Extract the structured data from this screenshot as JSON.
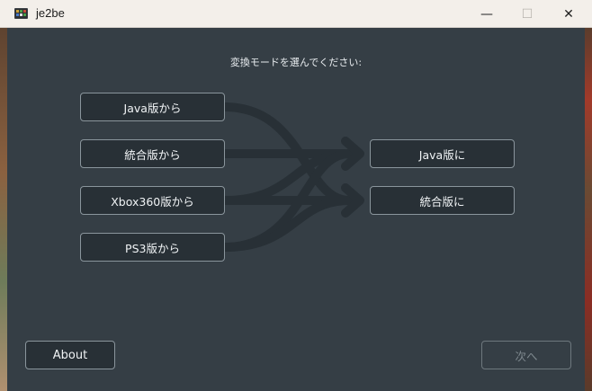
{
  "window": {
    "title": "je2be",
    "controls": {
      "minimize": "—",
      "maximize": "☐",
      "close": "✕"
    }
  },
  "main": {
    "prompt": "変換モードを選んでください:",
    "sources": [
      {
        "label": "Java版から"
      },
      {
        "label": "統合版から"
      },
      {
        "label": "Xbox360版から"
      },
      {
        "label": "PS3版から"
      }
    ],
    "targets": [
      {
        "label": "Java版に"
      },
      {
        "label": "統合版に"
      }
    ]
  },
  "footer": {
    "about_label": "About",
    "next_label": "次へ"
  },
  "colors": {
    "background": "#353e45",
    "button": "#283036",
    "button_border": "#8a959c",
    "flow_arrows": "#283036",
    "disabled_text": "#7e888e"
  }
}
